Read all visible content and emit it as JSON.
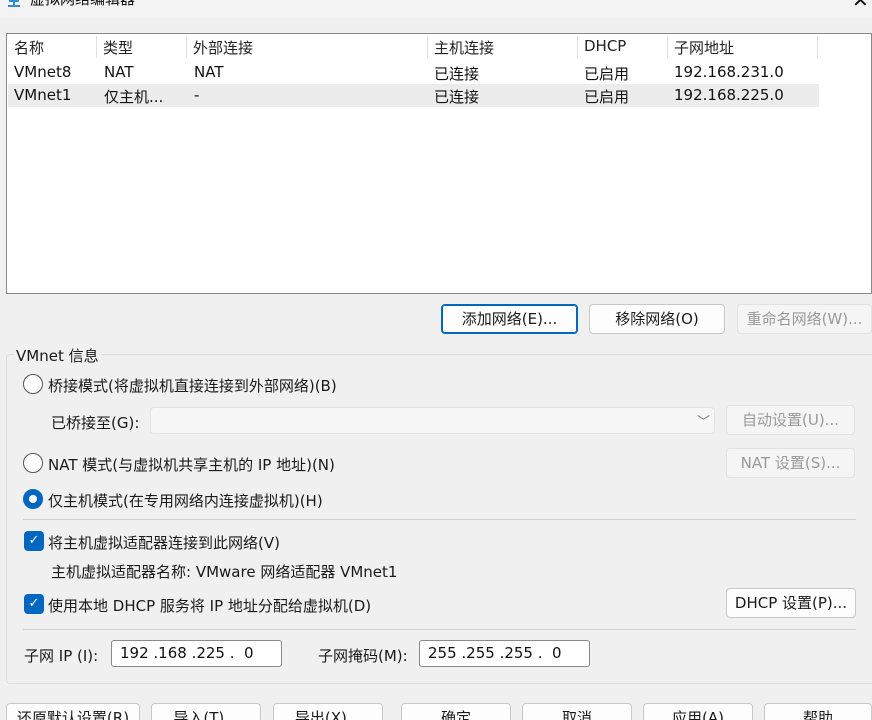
{
  "window": {
    "title": "虚拟网络编辑器",
    "close_glyph": "✕"
  },
  "table": {
    "headers": [
      "名称",
      "类型",
      "外部连接",
      "主机连接",
      "DHCP",
      "子网地址"
    ],
    "rows": [
      [
        "VMnet8",
        "NAT",
        "NAT",
        "已连接",
        "已启用",
        "192.168.231.0"
      ],
      [
        "VMnet1",
        "仅主机...",
        "-",
        "已连接",
        "已启用",
        "192.168.225.0"
      ]
    ],
    "selected_row": 1
  },
  "table_buttons": {
    "add": "添加网络(E)...",
    "remove": "移除网络(O)",
    "rename": "重命名网络(W)..."
  },
  "vmnet_info": {
    "group_label": "VMnet 信息",
    "bridged_label": "桥接模式(将虚拟机直接连接到外部网络)(B)",
    "bridged_to_label": "已桥接至(G):",
    "bridged_to_value": "",
    "auto_settings": "自动设置(U)...",
    "nat_label": "NAT 模式(与虚拟机共享主机的 IP 地址)(N)",
    "nat_settings": "NAT 设置(S)...",
    "hostonly_label": "仅主机模式(在专用网络内连接虚拟机)(H)",
    "selected_mode": "hostonly",
    "connect_adapter_label": "将主机虚拟适配器连接到此网络(V)",
    "connect_adapter_checked": true,
    "adapter_name_label": "主机虚拟适配器名称: VMware 网络适配器 VMnet1",
    "use_dhcp_label": "使用本地 DHCP 服务将 IP 地址分配给虚拟机(D)",
    "use_dhcp_checked": true,
    "dhcp_settings": "DHCP 设置(P)...",
    "subnet_ip_label": "子网 IP (I):",
    "subnet_ip": "192 .168 .225 .  0",
    "subnet_mask_label": "子网掩码(M):",
    "subnet_mask": "255 .255 .255 .  0"
  },
  "footer_buttons": {
    "restore": "还原默认设置(R)",
    "import": "导入(T)...",
    "export": "导出(X)...",
    "ok": "确定",
    "cancel": "取消",
    "apply": "应用(A)",
    "help": "帮助"
  },
  "colors": {
    "accent": "#0067c0",
    "window_bg": "#f0f0f0",
    "selected_row": "#ececec"
  },
  "icons": {
    "title": "network-editor-icon",
    "close": "close-icon",
    "combo": "chevron-down-icon",
    "checkbox": "checkmark-icon"
  }
}
